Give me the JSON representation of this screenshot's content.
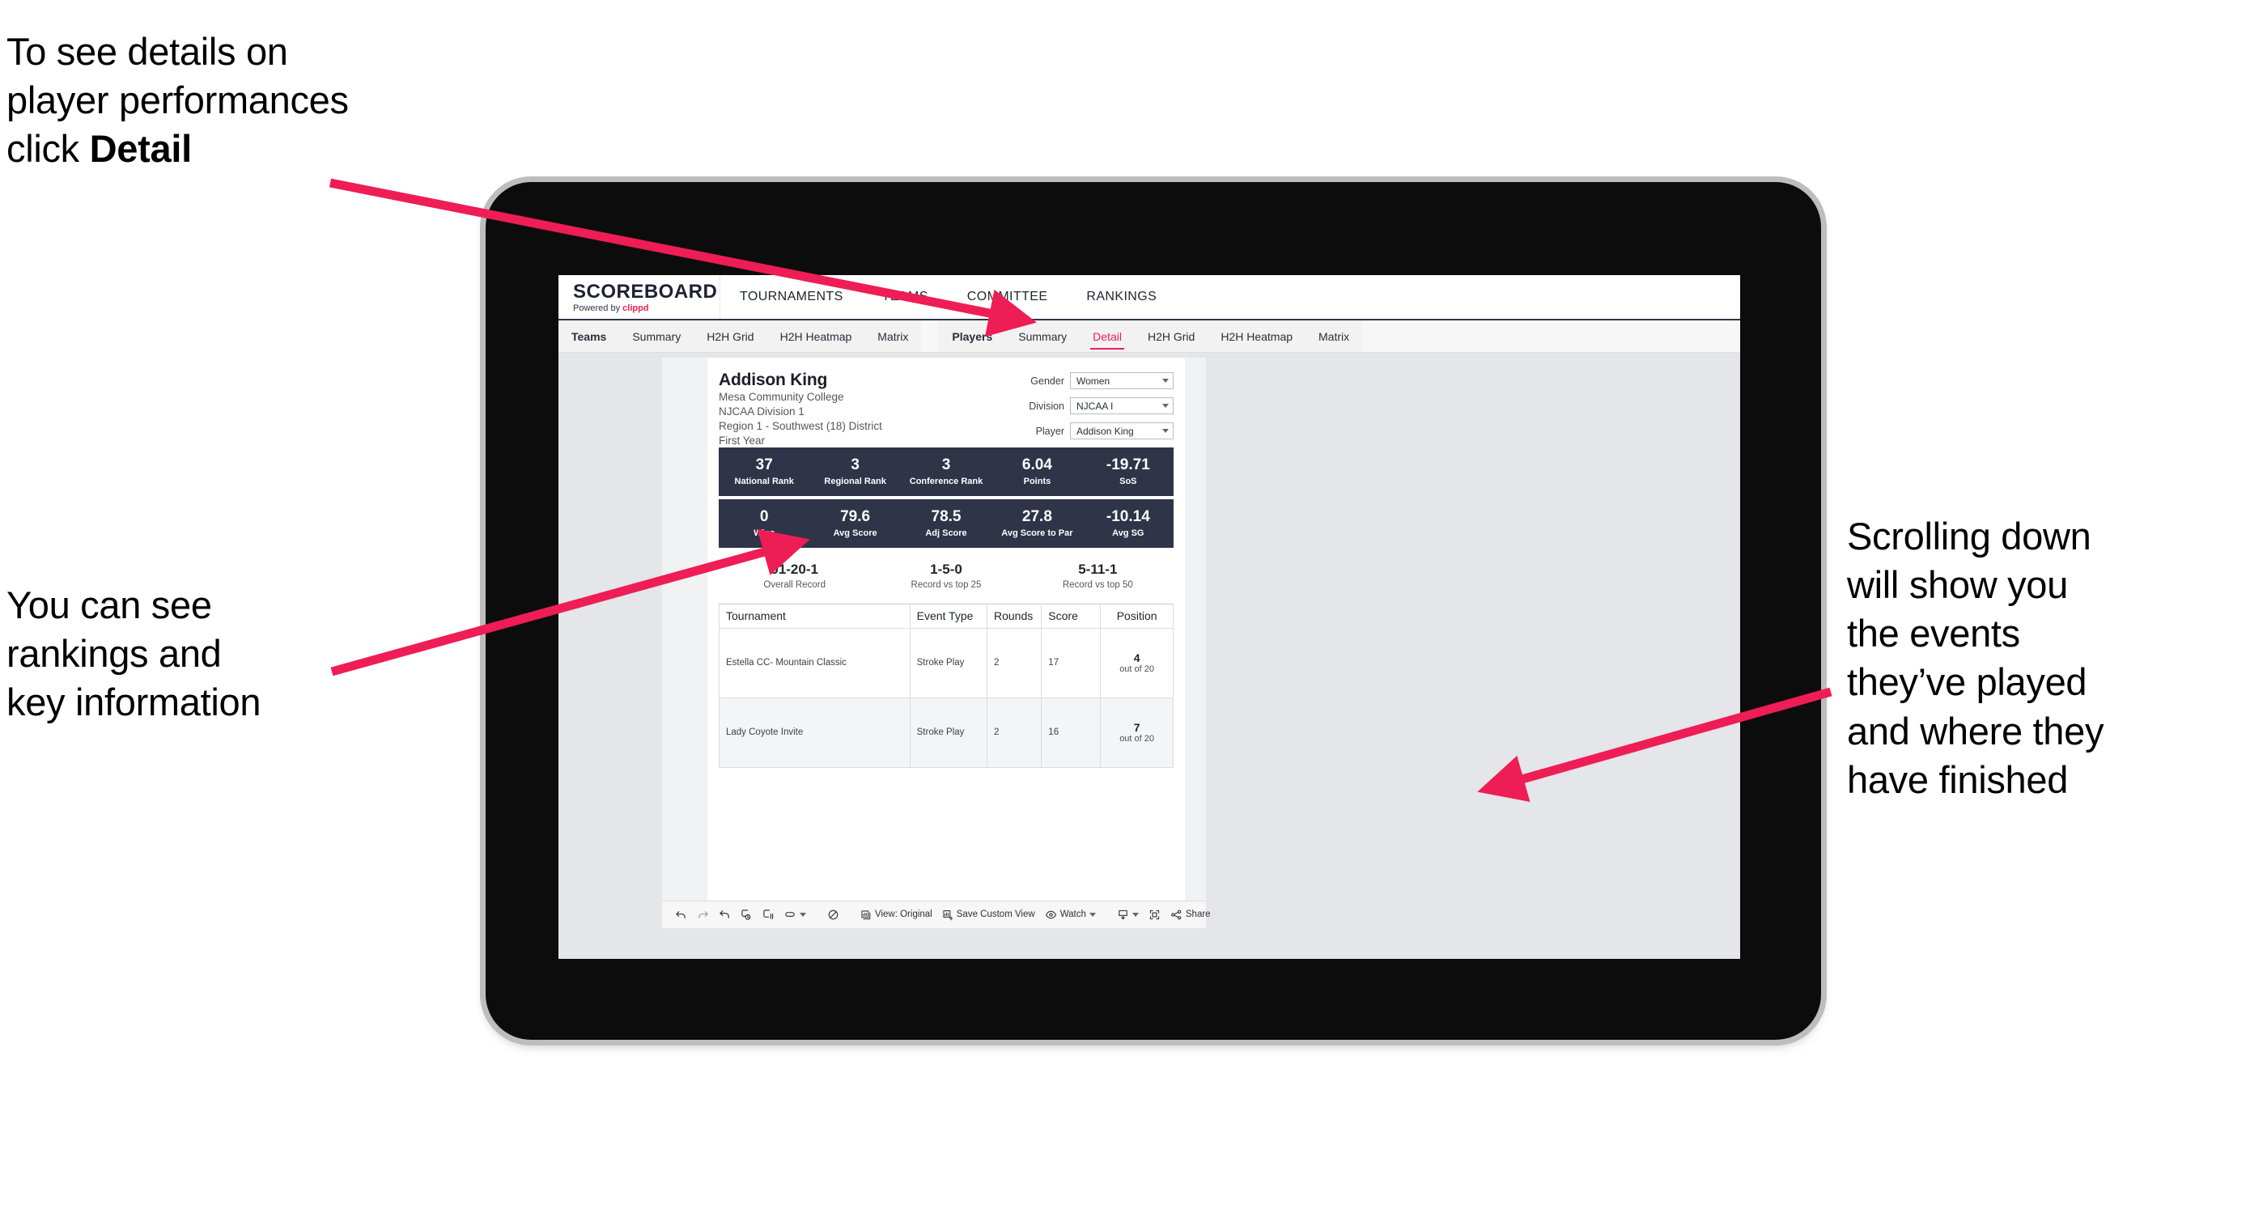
{
  "annotations": {
    "top_left": {
      "line1": "To see details on",
      "line2": "player performances",
      "line3_prefix": "click ",
      "line3_bold": "Detail"
    },
    "mid_left": {
      "line1": "You can see",
      "line2": "rankings and",
      "line3": "key information"
    },
    "right": {
      "line1": "Scrolling down",
      "line2": "will show you",
      "line3": "the events",
      "line4": "they’ve played",
      "line5": "and where they",
      "line6": "have finished"
    },
    "arrow_color": "#ef1d55"
  },
  "app": {
    "brand": {
      "title": "SCOREBOARD",
      "powered_prefix": "Powered by ",
      "powered_name": "clippd"
    },
    "main_nav": [
      {
        "label": "TOURNAMENTS"
      },
      {
        "label": "TEAMS"
      },
      {
        "label": "COMMITTEE"
      },
      {
        "label": "RANKINGS"
      }
    ],
    "sub_nav_teams": [
      {
        "label": "Teams",
        "active": false
      },
      {
        "label": "Summary",
        "active": false
      },
      {
        "label": "H2H Grid",
        "active": false
      },
      {
        "label": "H2H Heatmap",
        "active": false
      },
      {
        "label": "Matrix",
        "active": false
      }
    ],
    "sub_nav_players": [
      {
        "label": "Players",
        "active": false
      },
      {
        "label": "Summary",
        "active": false
      },
      {
        "label": "Detail",
        "active": true
      },
      {
        "label": "H2H Grid",
        "active": false
      },
      {
        "label": "H2H Heatmap",
        "active": false
      },
      {
        "label": "Matrix",
        "active": false
      }
    ],
    "accent_color": "#ef1d55",
    "stat_bar_color": "#2f3449"
  },
  "player": {
    "name": "Addison King",
    "school": "Mesa Community College",
    "division": "NJCAA Division 1",
    "region": "Region 1 - Southwest (18) District",
    "class_year": "First Year"
  },
  "filters": [
    {
      "label": "Gender",
      "value": "Women"
    },
    {
      "label": "Division",
      "value": "NJCAA I"
    },
    {
      "label": "Player",
      "value": "Addison King"
    }
  ],
  "stats_row_1": [
    {
      "value": "37",
      "label": "National Rank"
    },
    {
      "value": "3",
      "label": "Regional Rank"
    },
    {
      "value": "3",
      "label": "Conference Rank"
    },
    {
      "value": "6.04",
      "label": "Points"
    },
    {
      "value": "-19.71",
      "label": "SoS"
    }
  ],
  "stats_row_2": [
    {
      "value": "0",
      "label": "Wins"
    },
    {
      "value": "79.6",
      "label": "Avg Score"
    },
    {
      "value": "78.5",
      "label": "Adj Score"
    },
    {
      "value": "27.8",
      "label": "Avg Score to Par"
    },
    {
      "value": "-10.14",
      "label": "Avg SG"
    }
  ],
  "records": [
    {
      "value": "91-20-1",
      "label": "Overall Record"
    },
    {
      "value": "1-5-0",
      "label": "Record vs top 25"
    },
    {
      "value": "5-11-1",
      "label": "Record vs top 50"
    }
  ],
  "tournament_table": {
    "columns": [
      "Tournament",
      "Event Type",
      "Rounds",
      "Score",
      "Position"
    ],
    "rows": [
      {
        "tournament": "Estella CC- Mountain Classic",
        "event_type": "Stroke Play",
        "rounds": "2",
        "score": "17",
        "position_rank": "4",
        "position_of": "out of 20"
      },
      {
        "tournament": "Lady Coyote Invite",
        "event_type": "Stroke Play",
        "rounds": "2",
        "score": "16",
        "position_rank": "7",
        "position_of": "out of 20"
      }
    ]
  },
  "toolbar": {
    "view_label": "View: Original",
    "save_custom_view_label": "Save Custom View",
    "watch_label": "Watch",
    "share_label": "Share"
  }
}
